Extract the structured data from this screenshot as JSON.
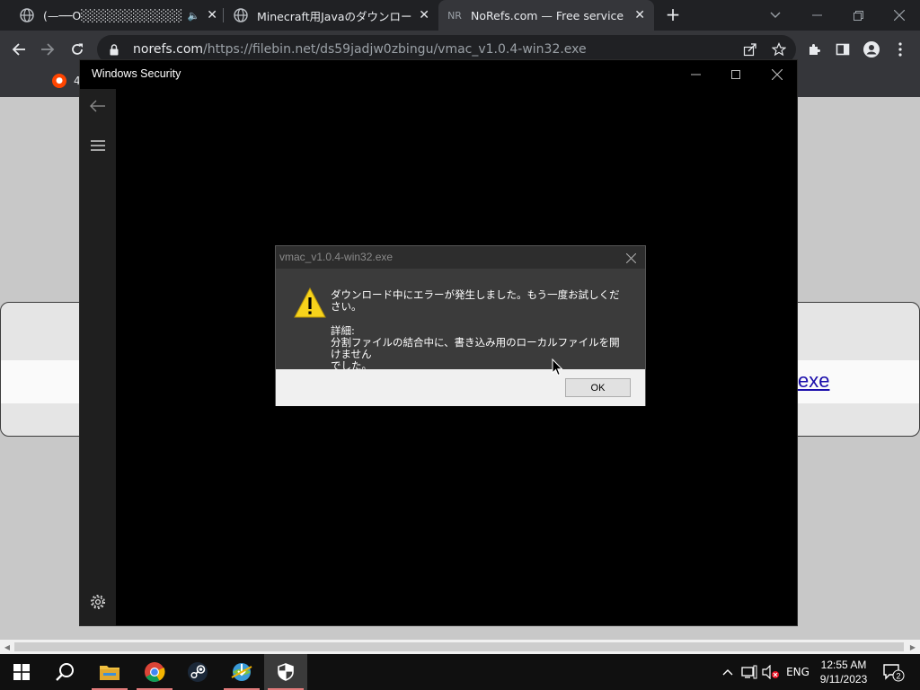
{
  "browser": {
    "tabs": [
      {
        "title": "(—──O░░░░░░░░░░░░░_",
        "icon": "globe-icon",
        "audio": "🔈"
      },
      {
        "title": "Minecraft用Javaのダウンロード（推",
        "icon": "globe-icon"
      },
      {
        "title": "NoRefs.com — Free service to re",
        "icon_text": "NR",
        "active": true
      }
    ],
    "new_tab": "+",
    "close_glyph": "✕",
    "url_host": "norefs.com",
    "url_path": "/https://filebin.net/ds59jadjw0zbingu/vmac_v1.0.4-win32.exe",
    "bookmark_label": "4"
  },
  "page": {
    "link_text": "exe"
  },
  "windows_security": {
    "title": "Windows Security"
  },
  "dialog": {
    "title": "vmac_v1.0.4-win32.exe",
    "message": "ダウンロード中にエラーが発生しました。もう一度お試しください。",
    "detail_label": "詳細:",
    "detail_line1": "分割ファイルの結合中に、書き込み用のローカルファイルを開けません",
    "detail_line2": "でした。",
    "ok_label": "OK"
  },
  "taskbar": {
    "lang": "ENG",
    "time": "12:55 AM",
    "date": "9/11/2023",
    "notifications": "2",
    "colors": {
      "chrome_red": "#db4437",
      "chrome_green": "#0f9d58",
      "chrome_yellow": "#f4b400",
      "chrome_blue": "#4285f4",
      "folder": "#f0c040",
      "steam": "#1b2838"
    }
  }
}
